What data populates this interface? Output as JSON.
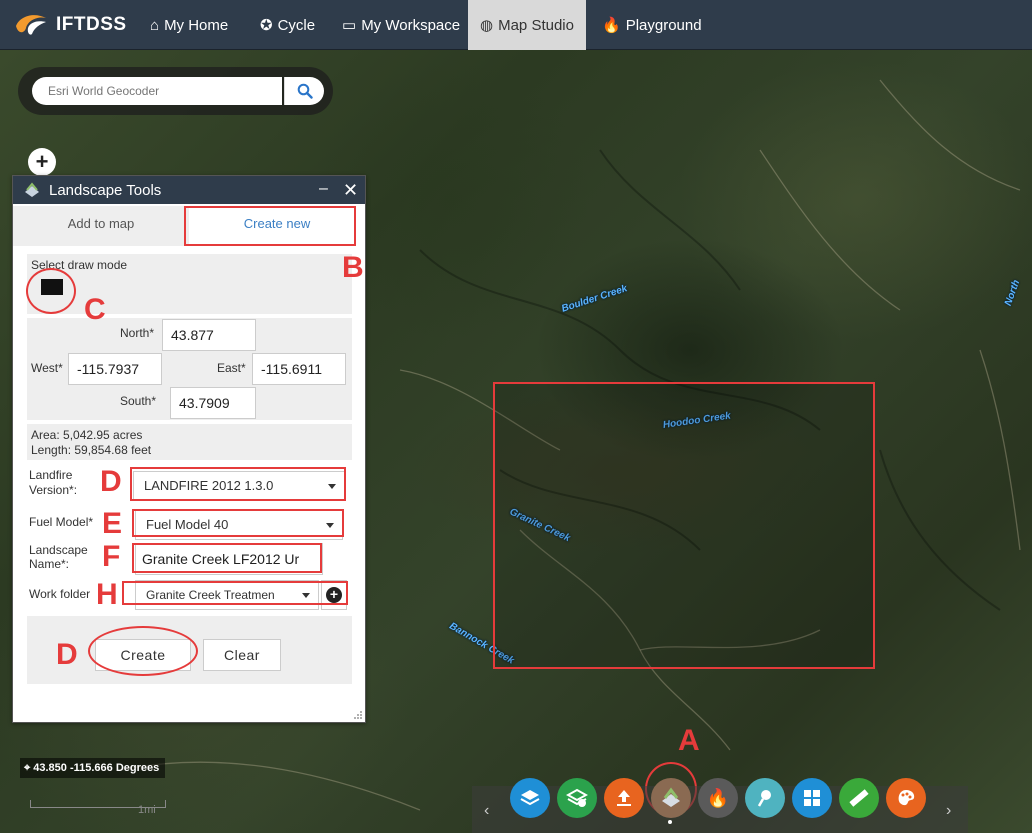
{
  "nav": {
    "brand": "IFTDSS",
    "items": [
      {
        "label": "My Home",
        "icon": "home-icon"
      },
      {
        "label": "Cycle",
        "icon": "cycle-icon"
      },
      {
        "label": "My Workspace",
        "icon": "workspace-icon"
      },
      {
        "label": "Map Studio",
        "icon": "globe-icon",
        "active": true
      },
      {
        "label": "Playground",
        "icon": "fire-icon"
      }
    ]
  },
  "search": {
    "placeholder": "Esri World Geocoder"
  },
  "panel": {
    "title": "Landscape Tools",
    "tabs": {
      "add": "Add to map",
      "create": "Create new"
    },
    "draw_mode_label": "Select draw mode",
    "bounds": {
      "north_label": "North*",
      "north": "43.877",
      "west_label": "West*",
      "west": "-115.7937",
      "east_label": "East*",
      "east": "-115.6911",
      "south_label": "South*",
      "south": "43.7909"
    },
    "area": "Area: 5,042.95 acres",
    "length": "Length: 59,854.68 feet",
    "landfire_label": "Landfire Version*:",
    "landfire_value": "LANDFIRE 2012 1.3.0",
    "fuel_label": "Fuel Model*",
    "fuel_value": "Fuel Model 40",
    "landscape_label": "Landscape Name*:",
    "landscape_value": "Granite Creek LF2012 Ur",
    "folder_label": "Work folder",
    "folder_value": "Granite Creek Treatmen",
    "create_label": "Create",
    "clear_label": "Clear"
  },
  "map": {
    "creeks": [
      "Boulder Creek",
      "Hoodoo Creek",
      "Granite Creek",
      "Bannock Creek",
      "North"
    ],
    "coords": "43.850 -115.666 Degrees",
    "scale_label": "1mi"
  },
  "annotations": {
    "A": "A",
    "B": "B",
    "C": "C",
    "D": "D",
    "E": "E",
    "F": "F",
    "H": "H",
    "D2": "D"
  },
  "toolbar": {
    "tools": [
      "layers-icon",
      "add-layer-icon",
      "upload-icon",
      "landscape-tools-icon",
      "fire-icon",
      "pin-icon",
      "grid-icon",
      "measure-icon",
      "palette-icon"
    ],
    "colors": [
      "#1f8fd6",
      "#2ba24c",
      "#e8641f",
      "#8a6a52",
      "#5a5a5a",
      "#4fb3c0",
      "#1f8fd6",
      "#3aa93a",
      "#e8641f"
    ]
  }
}
